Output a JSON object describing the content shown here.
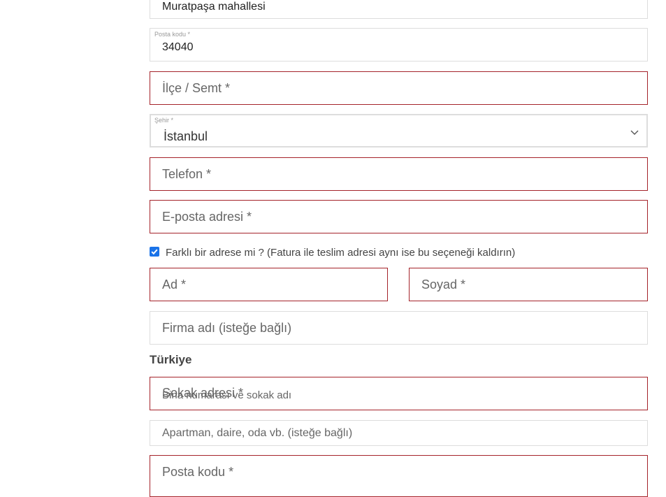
{
  "billing": {
    "mahalle_value": "Muratpaşa mahallesi",
    "postcode": {
      "label": "Posta kodu *",
      "value": "34040"
    },
    "district": {
      "placeholder": "İlçe / Semt *"
    },
    "city": {
      "label": "Şehir *",
      "value": "İstanbul"
    },
    "phone": {
      "placeholder": "Telefon *"
    },
    "email": {
      "placeholder": "E-posta adresi *"
    }
  },
  "ship_different": {
    "checked": true,
    "label": "Farklı bir adrese mi ? (Fatura ile teslim adresi aynı ise bu seçeneği kaldırın)"
  },
  "shipping": {
    "first_name": {
      "placeholder": "Ad *"
    },
    "last_name": {
      "placeholder": "Soyad *"
    },
    "company": {
      "placeholder": "Firma adı (isteğe bağlı)"
    },
    "country": "Türkiye",
    "street": {
      "label": "Sokak adresi *",
      "placeholder": "Bina numarası ve sokak adı"
    },
    "apartment": {
      "placeholder": "Apartman, daire, oda vb. (isteğe bağlı)"
    },
    "postcode": {
      "placeholder": "Posta kodu *"
    }
  },
  "colors": {
    "error_border": "#a5232a",
    "default_border": "#dddddd",
    "checkbox": "#1a73e8"
  },
  "icons": {
    "select_arrow": "chevron-down-icon",
    "checkbox_mark": "check-icon"
  }
}
